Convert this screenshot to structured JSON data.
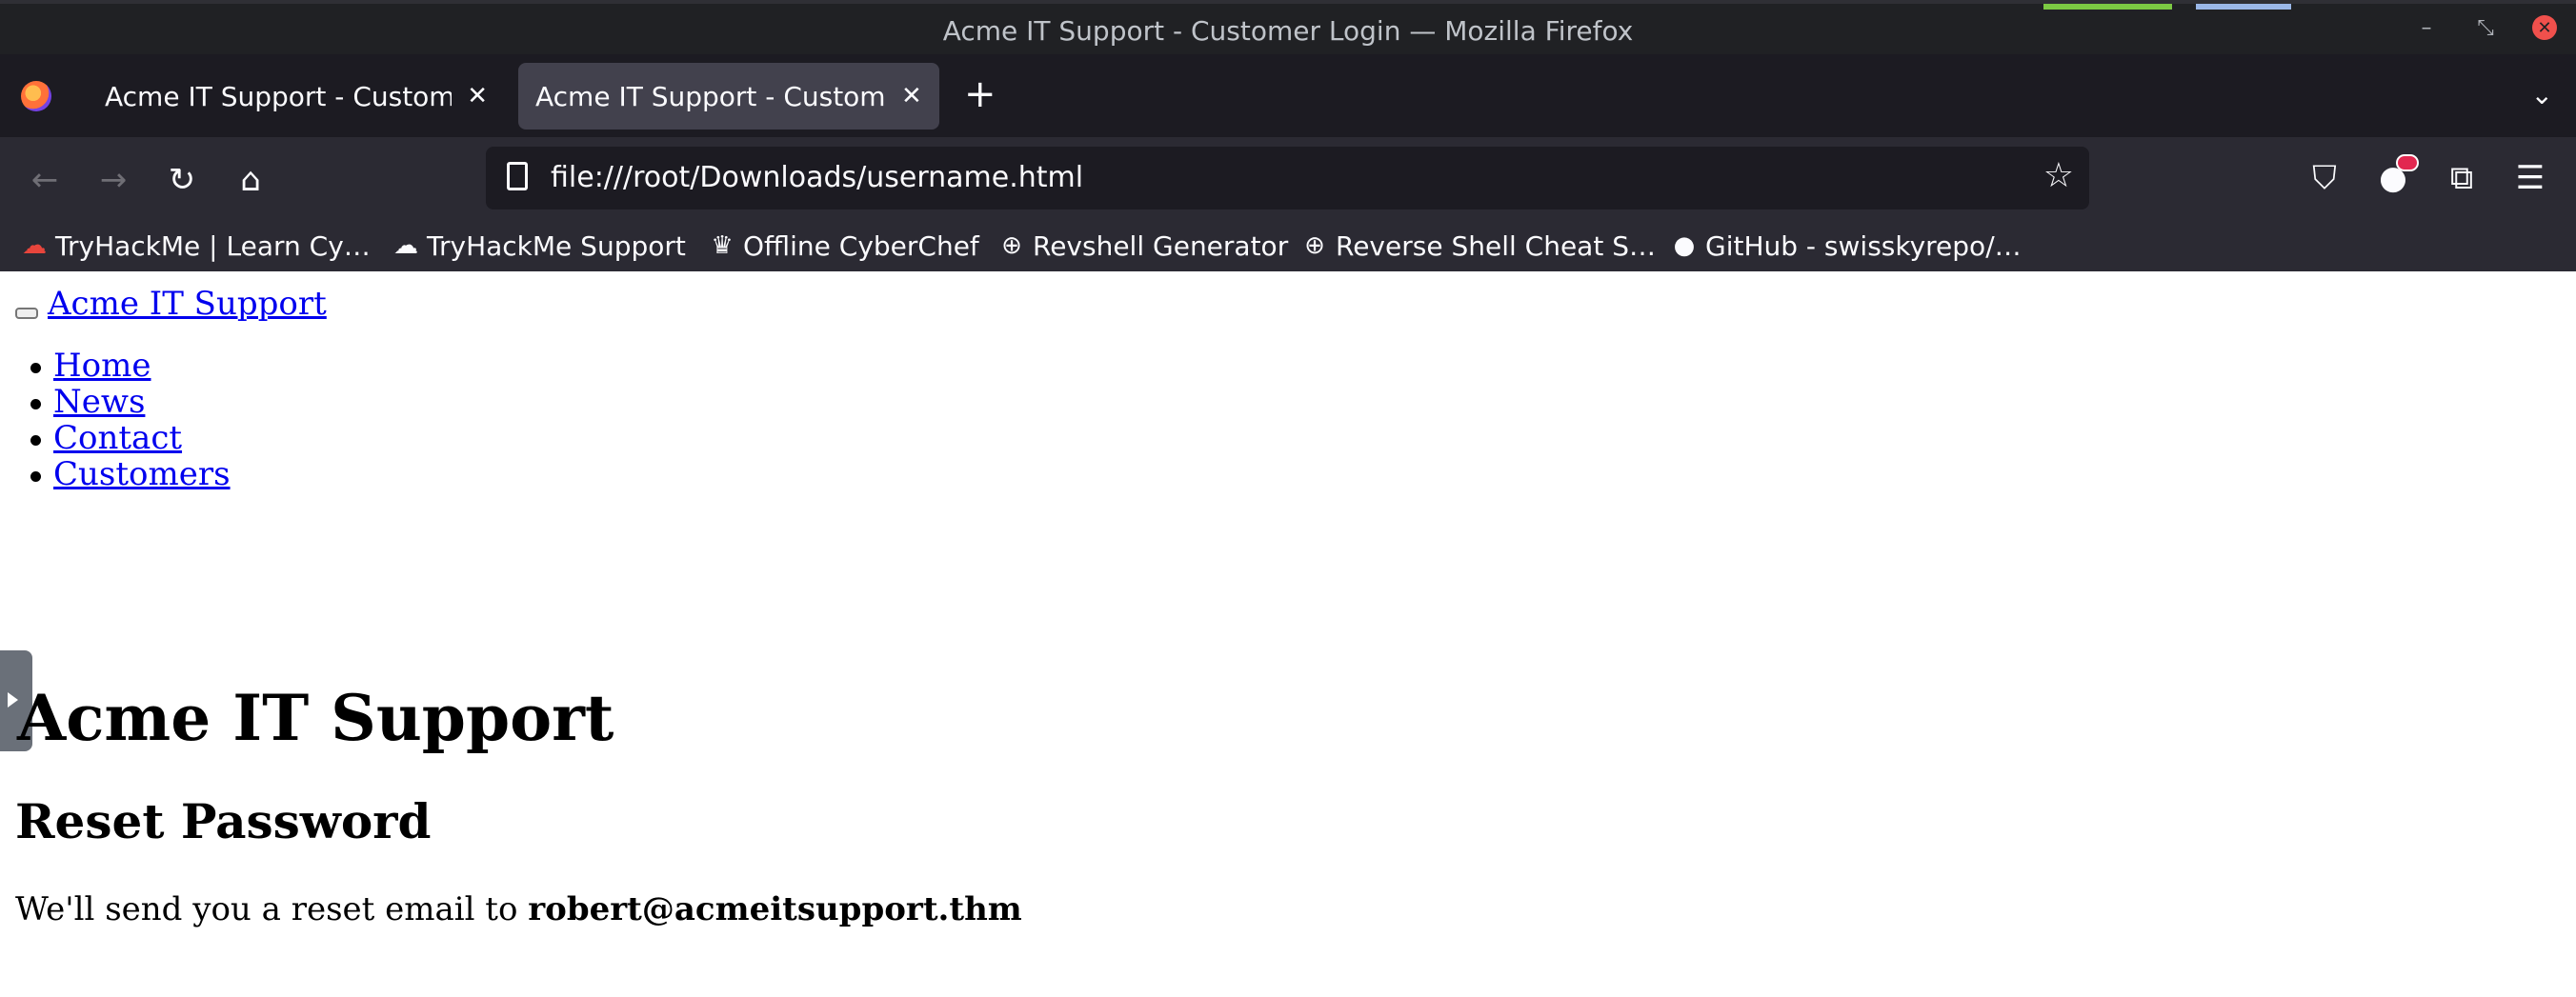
{
  "window": {
    "title": "Acme IT Support - Customer Login — Mozilla Firefox",
    "controls": [
      "minimize-icon",
      "restore-icon",
      "close-icon"
    ]
  },
  "tabs": [
    {
      "label": "Acme IT Support - Customer Login",
      "active": false
    },
    {
      "label": "Acme IT Support - Customer Login",
      "active": true
    }
  ],
  "toolbar": {
    "url": "file:///root/Downloads/username.html",
    "icons": [
      "back-icon",
      "forward-icon",
      "reload-icon",
      "home-icon",
      "bookmark-star-icon",
      "pocket-icon",
      "extension-icon",
      "extensions-icon",
      "menu-icon"
    ]
  },
  "bookmarks": [
    {
      "label": "TryHackMe | Learn Cy…",
      "icon": "tryhackme-icon"
    },
    {
      "label": "TryHackMe Support",
      "icon": "cloud-icon"
    },
    {
      "label": "Offline CyberChef",
      "icon": "chef-hat-icon"
    },
    {
      "label": "Revshell Generator",
      "icon": "globe-icon"
    },
    {
      "label": "Reverse Shell Cheat S…",
      "icon": "globe-icon"
    },
    {
      "label": "GitHub - swisskyrepo/…",
      "icon": "github-icon"
    }
  ],
  "page": {
    "brand": "Acme IT Support",
    "nav": [
      "Home",
      "News",
      "Contact",
      "Customers"
    ],
    "heading": "Acme IT Support",
    "subheading": "Reset Password",
    "message_prefix": "We'll send you a reset email to",
    "email": "robert@acmeitsupport.thm"
  },
  "colors": {
    "link": "#0000ee",
    "tab_active": "#42414d",
    "toolbar": "#2b2a33"
  }
}
